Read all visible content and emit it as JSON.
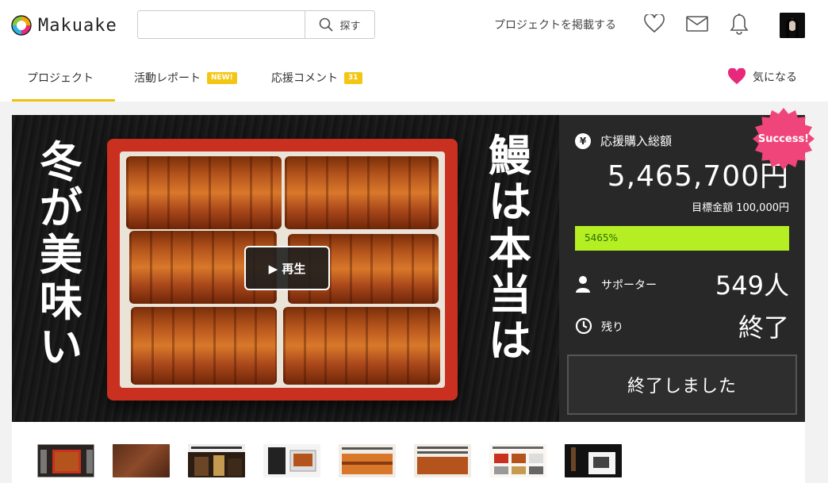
{
  "header": {
    "logo_text": "Makuake",
    "search": {
      "placeholder": "",
      "button_label": "探す"
    },
    "post_project_label": "プロジェクトを掲載する"
  },
  "tabs": {
    "items": [
      {
        "label": "プロジェクト",
        "badge": ""
      },
      {
        "label": "活動レポート",
        "badge": "NEW!"
      },
      {
        "label": "応援コメント",
        "badge": "31"
      }
    ],
    "favorite_label": "気になる"
  },
  "hero": {
    "left_text": "冬が美味い",
    "right_text": "鰻は本当は",
    "play_label": "▶ 再生"
  },
  "panel": {
    "amount_label": "応援購入総額",
    "currency_icon": "¥",
    "amount": "5,465,700円",
    "goal_label": "目標金額 100,000円",
    "progress_text": "5465%",
    "progress_fraction": 1.0,
    "supporters_label": "サポーター",
    "supporters_value": "549人",
    "remaining_label": "残り",
    "remaining_value": "終了",
    "end_button_label": "終了しました",
    "success_badge": "Success!"
  },
  "colors": {
    "accent_yellow": "#f0c20b",
    "progress_green": "#b5ee22",
    "panel_bg": "#282828",
    "success_pink": "#f0457a",
    "heart_pink": "#e8287a"
  },
  "thumbnails": [
    {
      "name": "thumb-1"
    },
    {
      "name": "thumb-2"
    },
    {
      "name": "thumb-3"
    },
    {
      "name": "thumb-4"
    },
    {
      "name": "thumb-5"
    },
    {
      "name": "thumb-6"
    },
    {
      "name": "thumb-7"
    },
    {
      "name": "thumb-8"
    }
  ]
}
